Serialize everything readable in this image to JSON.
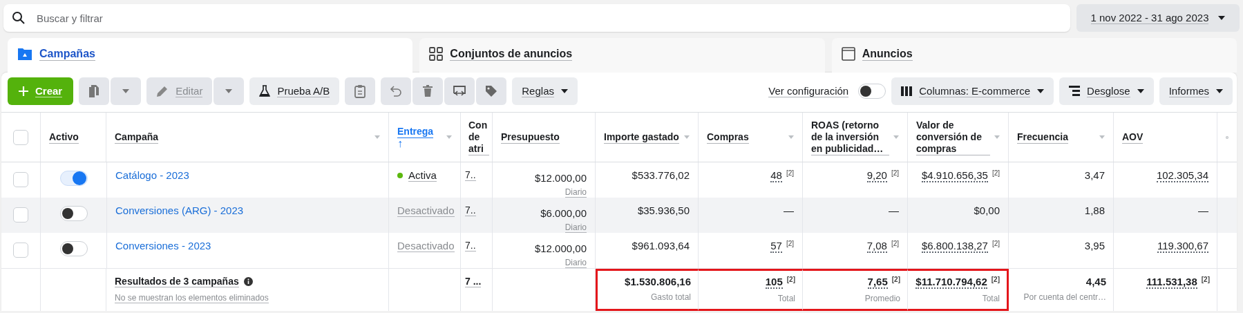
{
  "search": {
    "placeholder": "Buscar y filtrar"
  },
  "date_range": "1 nov 2022 - 31 ago 2023",
  "tabs": [
    {
      "label": "Campañas",
      "selected": true
    },
    {
      "label": "Conjuntos de anuncios",
      "selected": false
    },
    {
      "label": "Anuncios",
      "selected": false
    }
  ],
  "toolbar": {
    "create": "Crear",
    "edit": {
      "label": "Editar",
      "disabled": true
    },
    "ab_test": "Prueba A/B",
    "rules": "Reglas",
    "view_settings": {
      "label": "Ver configuración",
      "on": false
    },
    "columns": "Columnas: E-commerce",
    "breakdown": "Desglose",
    "reports": "Informes"
  },
  "table": {
    "header_checkbox": {
      "checked": false
    },
    "columns": [
      {
        "label": "Activo",
        "menu": false,
        "sorted": false
      },
      {
        "label": "Campaña",
        "menu": true,
        "sorted": false
      },
      {
        "label": "Entrega",
        "menu": true,
        "sorted": true,
        "sort_arrow": "↑"
      },
      {
        "label": "Con de atri",
        "menu": false,
        "sorted": false
      },
      {
        "label": "Presupuesto",
        "menu": false,
        "sorted": false
      },
      {
        "label": "Importe gastado",
        "menu": true,
        "sorted": false
      },
      {
        "label": "Compras",
        "menu": true,
        "sorted": false
      },
      {
        "label": "ROAS (retorno de la inversión en publicidad…",
        "menu": true,
        "sorted": false
      },
      {
        "label": "Valor de conversión de compras",
        "menu": true,
        "sorted": false
      },
      {
        "label": "Frecuencia",
        "menu": true,
        "sorted": false
      },
      {
        "label": "AOV",
        "menu": false,
        "sorted": false
      }
    ],
    "rows": [
      {
        "checked": false,
        "on": true,
        "hovered": false,
        "name": "Catálogo - 2023",
        "status": {
          "label": "Activa",
          "active": true
        },
        "attribution": "7..",
        "budget": {
          "text": "$12.000,00",
          "sub": "Diario"
        },
        "metrics": [
          {
            "text": "$533.776,02",
            "dotted": false
          },
          {
            "text": "48",
            "note": "[2]",
            "dotted": true
          },
          {
            "text": "9,20",
            "note": "[2]",
            "dotted": true
          },
          {
            "text": "$4.910.656,35",
            "note": "[2]",
            "dotted": true
          },
          {
            "text": "3,47",
            "dotted": false
          },
          {
            "text": "102.305,34",
            "dotted": true
          }
        ]
      },
      {
        "checked": false,
        "on": false,
        "hovered": true,
        "name": "Conversiones (ARG) - 2023",
        "status": {
          "label": "Desactivado",
          "active": false
        },
        "attribution": "7..",
        "budget": {
          "text": "$6.000,00",
          "sub": "Diario"
        },
        "metrics": [
          {
            "text": "$35.936,50",
            "dotted": false
          },
          {
            "text": "—",
            "dotted": false
          },
          {
            "text": "—",
            "dotted": false
          },
          {
            "text": "$0,00",
            "dotted": false
          },
          {
            "text": "1,88",
            "dotted": false
          },
          {
            "text": "—",
            "dotted": false
          }
        ]
      },
      {
        "checked": false,
        "on": false,
        "hovered": false,
        "name": "Conversiones - 2023",
        "status": {
          "label": "Desactivado",
          "active": false
        },
        "attribution": "7..",
        "budget": {
          "text": "$12.000,00",
          "sub": "Diario"
        },
        "metrics": [
          {
            "text": "$961.093,64",
            "dotted": false
          },
          {
            "text": "57",
            "note": "[2]",
            "dotted": true
          },
          {
            "text": "7,08",
            "note": "[2]",
            "dotted": true
          },
          {
            "text": "$6.800.138,27",
            "note": "[2]",
            "dotted": true
          },
          {
            "text": "3,95",
            "dotted": false
          },
          {
            "text": "119.300,67",
            "dotted": true
          }
        ]
      }
    ],
    "summary": {
      "label": "Resultados de 3 campañas",
      "sub": "No se muestran los elementos eliminados",
      "attribution": "7 ...",
      "metrics": [
        {
          "text": "$1.530.806,16",
          "sub": "Gasto total",
          "dotted": false,
          "highlighted": true
        },
        {
          "text": "105",
          "note": "[2]",
          "sub": "Total",
          "dotted": true,
          "highlighted": true
        },
        {
          "text": "7,65",
          "note": "[2]",
          "sub": "Promedio",
          "dotted": true,
          "highlighted": true
        },
        {
          "text": "$11.710.794,62",
          "note": "[2]",
          "sub": "Total",
          "dotted": true,
          "highlighted": true
        },
        {
          "text": "4,45",
          "sub": "Por cuenta del centr…",
          "dotted": false,
          "highlighted": false
        },
        {
          "text": "111.531,38",
          "note": "[2]",
          "dotted": true,
          "highlighted": false
        }
      ]
    }
  }
}
